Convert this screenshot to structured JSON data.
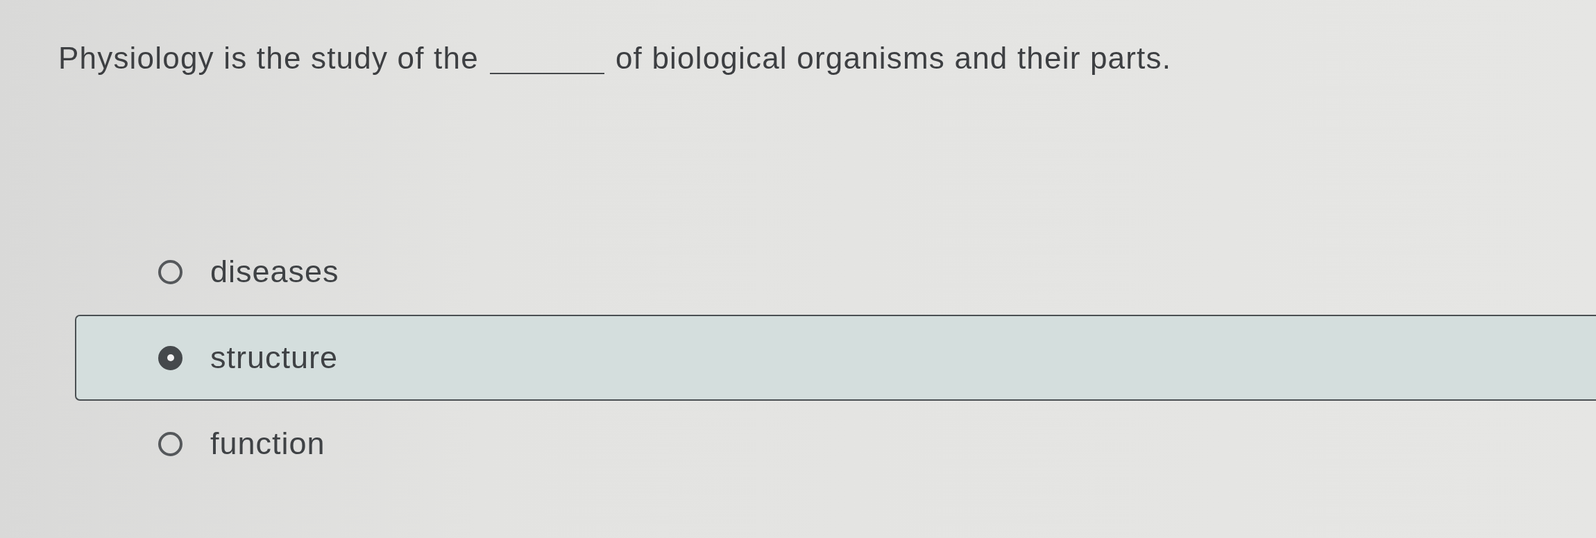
{
  "question": {
    "text_before": "Physiology is the study of the",
    "text_after": "of biological organisms and their parts."
  },
  "options": [
    {
      "label": "diseases",
      "selected": false
    },
    {
      "label": "structure",
      "selected": true
    },
    {
      "label": "function",
      "selected": false
    }
  ]
}
